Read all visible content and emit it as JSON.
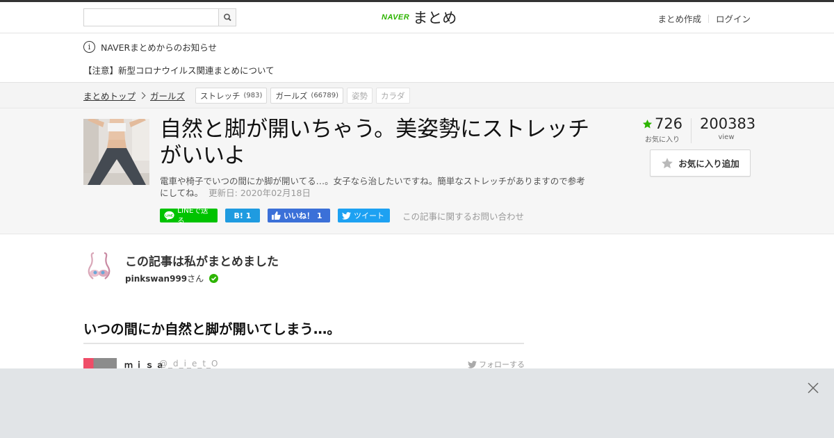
{
  "header": {
    "search_placeholder": "",
    "logo_naver": "NAVER",
    "logo_matome": "まとめ",
    "nav": [
      "まとめ作成",
      "ログイン"
    ]
  },
  "notice": {
    "info_text": "NAVERまとめからのお知らせ",
    "corona_link": "【注意】新型コロナウイルス関連まとめについて"
  },
  "breadcrumb": {
    "top": "まとめトップ",
    "category": "ガールズ",
    "tags": [
      {
        "label": "ストレッチ",
        "count": "(983)"
      },
      {
        "label": "ガールズ",
        "count": "(66789)"
      },
      {
        "label": "姿勢",
        "count": ""
      },
      {
        "label": "カラダ",
        "count": ""
      }
    ]
  },
  "article": {
    "title": "自然と脚が開いちゃう。美姿勢にストレッチがいいよ",
    "description": "電車や椅子でいつの間にか脚が開いてる…。女子なら治したいですね。簡単なストレッチがありますので参考にしてね。",
    "updated": "更新日: 2020年02月18日",
    "share": {
      "line": "LINEで送る",
      "hatena": "B! 1",
      "facebook": "いいね！ 1",
      "twitter": "ツイート",
      "inquiry": "この記事に関するお問い合わせ"
    },
    "stats": {
      "favorites": "726",
      "favorites_label": "お気に入り",
      "views": "200383",
      "views_label": "view"
    },
    "fav_button": "お気に入り追加"
  },
  "author": {
    "heading": "この記事は私がまとめました",
    "name": "pinkswan999",
    "suffix": "さん"
  },
  "section": {
    "heading": "いつの間にか自然と脚が開いてしまう…。"
  },
  "tweet": {
    "name": "ｍｉｓａ",
    "handle": "@_d_i_e_t_O",
    "follow": "フォローする"
  },
  "colors": {
    "naver_green": "#2db400",
    "line_green": "#00c300",
    "hatena_blue": "#1f9be0",
    "facebook_blue": "#3b70d8",
    "twitter_blue": "#1da1f2",
    "overlay_gray": "#e1e4e7"
  }
}
